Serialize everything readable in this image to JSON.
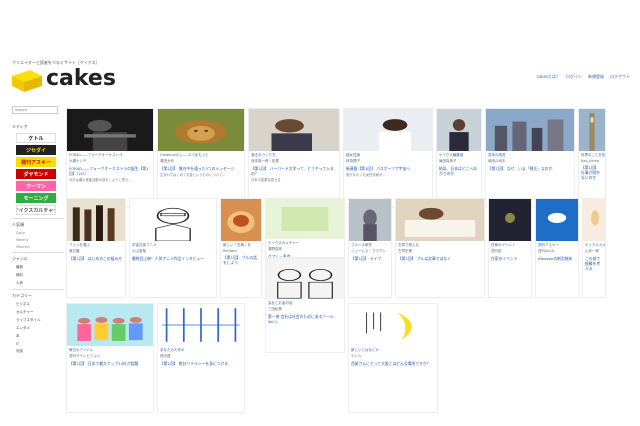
{
  "header": {
    "tagline": "クリエイターと読者をつなぐサイト［ケイクス］",
    "logo_text": "cakes",
    "links": [
      "cakesとは？",
      "ログイン",
      "新規登録",
      "ログアウト"
    ]
  },
  "sidebar": {
    "search_placeholder": "Search",
    "media_title": "メディア",
    "media_badges": [
      {
        "label": "ケトル",
        "bg": "#ffffff",
        "fg": "#111111"
      },
      {
        "label": "ジセダイ",
        "bg": "#222222",
        "fg": "#ffdd00"
      },
      {
        "label": "週刊アスキー",
        "bg": "#ffdd00",
        "fg": "#cc0000"
      },
      {
        "label": "ダヤモンド",
        "bg": "#cc0000",
        "fg": "#ffffff"
      },
      {
        "label": "ウーマン",
        "bg": "#ff66aa",
        "fg": "#ffffff"
      },
      {
        "label": "モーニング",
        "bg": "#33aa44",
        "fg": "#ffffff"
      },
      {
        "label": "ケイクスカルチャー",
        "bg": "#ffffff",
        "fg": "#555555"
      }
    ],
    "ranking_title": "人気順",
    "ranking_links": [
      "Daily",
      "Weekly",
      "Monthly"
    ],
    "genre_title": "ジャンル",
    "genre_links": [
      "最新",
      "無料",
      "人気"
    ],
    "category_title": "カテゴリー",
    "category_links": [
      "ビジネス",
      "カルチャー",
      "ライフスタイル",
      "エンタメ",
      "本",
      "IT",
      "対談"
    ]
  },
  "cards": [
    {
      "meta": "FOR40――フォークオーケストラ",
      "author": "大槻ケンヂ",
      "title": "FOR40――フォークオーケストラの誕生【第1回】（2/2）",
      "excerpt": "今日は僕の音楽活動の話をしようと思う…",
      "thumb": "guitar"
    },
    {
      "meta": "Continue(C)――ネコをもっと",
      "author": "湯田大作",
      "title": "【第1回】 僕の中を通った3つのメッセージ",
      "excerpt": "生まれてはじめてお金というものについて…",
      "thumb": "lion"
    },
    {
      "meta": "漫才のつくり方",
      "author": "西本雄一郎・松尾",
      "title": "【第1回】 ハーバード大学って、どうやって入るの？",
      "excerpt": "日本の成果を見せる",
      "thumb": "man"
    },
    {
      "meta": "超女性論",
      "author": "林真理子",
      "title": "新連載【第1回】 パスポーツで宇宙へ",
      "excerpt": "旅行なかった女性作家が…",
      "thumb": "woman"
    },
    {
      "meta": "ケイクス編集部",
      "author": "篠田真貴子",
      "title": "結局、日本はどこへ向かうのか",
      "excerpt": "",
      "thumb": "office"
    },
    {
      "meta": "週末の読書",
      "author": "岡田斗司夫",
      "title": "【第1回】 なぜ、いま「貧乏」なのか",
      "excerpt": "",
      "thumb": "city"
    },
    {
      "meta": "世界のことを知る",
      "author": "Kay_Koma",
      "title": "【第1回】 仕事が続かないのか",
      "excerpt": "",
      "thumb": "london"
    },
    {
      "meta": "ワインを選ぶ",
      "author": "渡辺隆",
      "title": "【第1回】 はじめるこの組み方",
      "excerpt": "",
      "thumb": "bottles"
    },
    {
      "meta": "宇宙兄弟アニメ",
      "author": "小山宙哉",
      "title": "最終回上映！人気アニメ作品インタビュー",
      "excerpt": "",
      "thumb": "manga"
    },
    {
      "meta": "新しい「古典」を",
      "author": "Rentaro",
      "title": "【第1回】 ブルの話をしよう",
      "excerpt": "",
      "thumb": "dish"
    },
    {
      "meta": "ケイクスカルチャー",
      "author": "湯野真彦",
      "title": "グアム・東京",
      "excerpt": "",
      "thumb": "culture"
    },
    {
      "meta": "ブルース研究",
      "author": "ジェームス・ブラウン",
      "title": "【第1回】 ライブ",
      "excerpt": "",
      "thumb": "statue"
    },
    {
      "meta": "文章で考える",
      "author": "古賀史健",
      "title": "【第1回】 ブルは文章ではなく",
      "excerpt": "",
      "thumb": "write"
    },
    {
      "meta": "作家のイベント",
      "author": "週刊誌",
      "title": "作家のイベント",
      "excerpt": "",
      "thumb": "dark"
    },
    {
      "meta": "週刊アスキー",
      "author": "週刊ASCII",
      "title": "Amazonの新型端末",
      "excerpt": "",
      "thumb": "skydrive"
    },
    {
      "meta": "ケイクスカルチャー",
      "author": "山本一郎",
      "title": "この前で経験を考える",
      "excerpt": "",
      "thumb": "lamp"
    },
    {
      "meta": "会社とお金の話",
      "author": "三田紀房",
      "title": "第一巻 会社は社会のためにあるツール Vol.1",
      "excerpt": "",
      "thumb": "comic"
    },
    {
      "meta": "毎日のアイドル",
      "author": "週刊ザテレビジョン",
      "title": "【第1回】 日本で最大アップ14社が話題",
      "excerpt": "",
      "thumb": "idols"
    },
    {
      "meta": "あなたのための",
      "author": "西内啓",
      "title": "【第1回】 統計リテラシーを身につける",
      "excerpt": "",
      "thumb": "lines"
    },
    {
      "meta": "新しいとはなにか",
      "author": "ケトル",
      "title": "西尾さんにとって大阪とはどんな場所ですか？",
      "excerpt": "",
      "thumb": "banana"
    }
  ]
}
